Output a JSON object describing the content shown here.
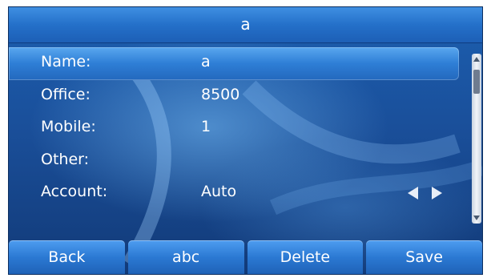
{
  "title": "a",
  "fields": [
    {
      "label": "Name:",
      "value": "a",
      "selected": true
    },
    {
      "label": "Office:",
      "value": "8500"
    },
    {
      "label": "Mobile:",
      "value": "1"
    },
    {
      "label": "Other:",
      "value": ""
    },
    {
      "label": "Account:",
      "value": "Auto",
      "has_arrows": true
    }
  ],
  "softkeys": [
    "Back",
    "abc",
    "Delete",
    "Save"
  ],
  "icons": {
    "arrow_left": "left-arrow-icon",
    "arrow_right": "right-arrow-icon",
    "scroll_up": "scroll-up-icon",
    "scroll_down": "scroll-down-icon"
  }
}
